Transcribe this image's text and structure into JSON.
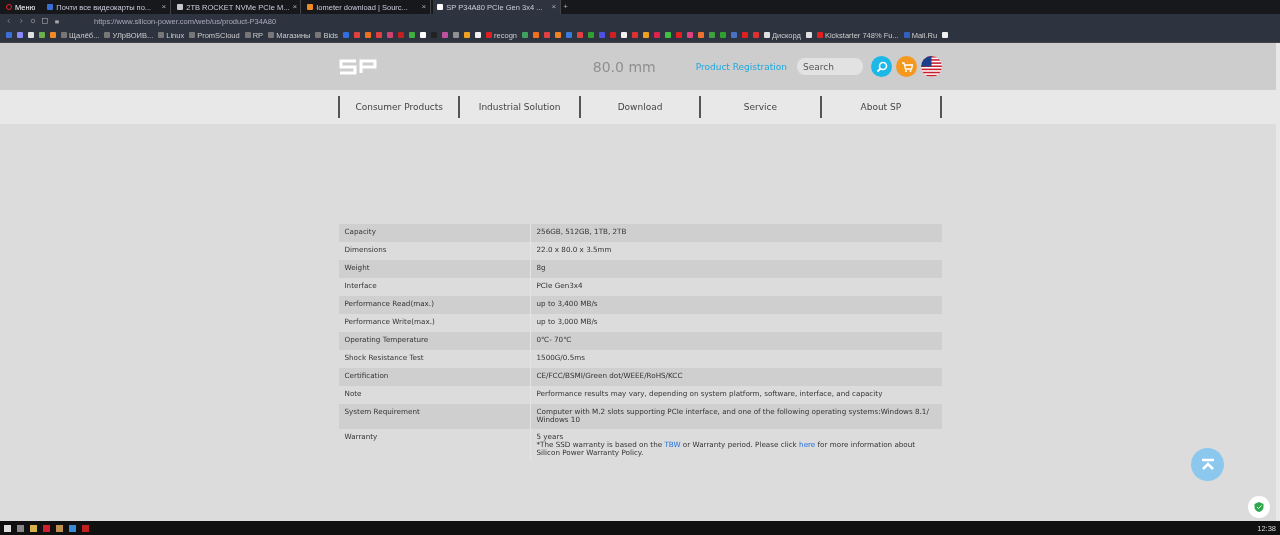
{
  "browser": {
    "menu_label": "Меню",
    "tabs": [
      {
        "title": "Почти все видеокарты по...",
        "selected": false,
        "color": "#3b6fd8",
        "close": "×"
      },
      {
        "title": "2TB ROCKET NVMe PCIe M...",
        "selected": false,
        "color": "#c8c8c8",
        "close": "×"
      },
      {
        "title": "Iometer download | Sourc...",
        "selected": false,
        "color": "#f08a24",
        "close": "×"
      },
      {
        "title": "SP P34A80 PCIe Gen 3x4 ...",
        "selected": true,
        "color": "#ffffff",
        "close": "×"
      }
    ],
    "new_tab": "+",
    "url": "https://www.silicon-power.com/web/us/product-P34A80",
    "bookmarks": [
      {
        "color": "#3b6fd8"
      },
      {
        "color": "#8a8aff"
      },
      {
        "color": "#e0e0e0"
      },
      {
        "color": "#6ab04c"
      },
      {
        "color": "#f08a24"
      },
      {
        "label": "Щалёб...",
        "color": "#777777"
      },
      {
        "label": "УЛрВОИВ...",
        "color": "#777777"
      },
      {
        "label": "Linux",
        "color": "#777777"
      },
      {
        "label": "PromSCloud",
        "color": "#777777"
      },
      {
        "label": "RP",
        "color": "#777777"
      },
      {
        "label": "Магазины",
        "color": "#777777"
      },
      {
        "label": "Bids",
        "color": "#777777"
      },
      {
        "color": "#2f6fe0"
      },
      {
        "color": "#e04040"
      },
      {
        "color": "#f07020"
      },
      {
        "color": "#e04040"
      },
      {
        "color": "#d04070"
      },
      {
        "color": "#c02020"
      },
      {
        "color": "#40b040"
      },
      {
        "color": "#ffffff"
      },
      {
        "color": "#222222"
      },
      {
        "color": "#c050a0"
      },
      {
        "color": "#909090"
      },
      {
        "color": "#f0a020"
      },
      {
        "color": "#f0f0f0"
      },
      {
        "label": "recogn",
        "color": "#e02020"
      },
      {
        "color": "#40a060"
      },
      {
        "color": "#f07020"
      },
      {
        "color": "#e04040"
      },
      {
        "color": "#f08020"
      },
      {
        "color": "#3a7ad8"
      },
      {
        "color": "#e04040"
      },
      {
        "color": "#30a030"
      },
      {
        "color": "#5050e0"
      },
      {
        "color": "#d02020"
      },
      {
        "color": "#f0f0f0"
      },
      {
        "color": "#e03030"
      },
      {
        "color": "#f0a020"
      },
      {
        "color": "#e02050"
      },
      {
        "color": "#40c040"
      },
      {
        "color": "#e02020"
      },
      {
        "color": "#e04080"
      },
      {
        "color": "#f07030"
      },
      {
        "color": "#40a040"
      },
      {
        "color": "#30a030"
      },
      {
        "color": "#4a70c0"
      },
      {
        "color": "#e02020"
      },
      {
        "color": "#e03030"
      },
      {
        "label": "Дискорд",
        "color": "#e0e0e0"
      },
      {
        "color": "#e0e0e0"
      },
      {
        "label": "Kickstarter 748% Fu...",
        "color": "#e02020"
      },
      {
        "label": "Mail.Ru",
        "color": "#3060c0"
      },
      {
        "color": "#f0f0f0"
      }
    ]
  },
  "header": {
    "caption": "80.0 mm",
    "registration_link": "Product Registration",
    "search": {
      "placeholder": "Search"
    }
  },
  "nav": [
    {
      "label": "Consumer Products"
    },
    {
      "label": "Industrial Solution"
    },
    {
      "label": "Download"
    },
    {
      "label": "Service"
    },
    {
      "label": "About SP"
    }
  ],
  "specs": [
    {
      "name": "Capacity",
      "value": [
        "256GB, 512GB, 1TB, 2TB"
      ]
    },
    {
      "name": "Dimensions",
      "value": [
        "22.0 x 80.0 x 3.5mm"
      ]
    },
    {
      "name": "Weight",
      "value": [
        "8g"
      ]
    },
    {
      "name": "Interface",
      "value": [
        "PCIe Gen3x4"
      ]
    },
    {
      "name": "Performance Read(max.)",
      "value": [
        "up to 3,400 MB/s"
      ]
    },
    {
      "name": "Performance Write(max.)",
      "value": [
        "up to 3,000 MB/s"
      ]
    },
    {
      "name": "Operating Temperature",
      "value": [
        "0℃- 70℃"
      ]
    },
    {
      "name": "Shock Resistance Test",
      "value": [
        "1500G/0.5ms"
      ]
    },
    {
      "name": "Certification",
      "value": [
        "CE/FCC/BSMI/Green dot/WEEE/RoHS/KCC"
      ]
    },
    {
      "name": "Note",
      "value": [
        "Performance results may vary, depending on system platform, software, interface, and capacity"
      ]
    },
    {
      "name": "System Requirement",
      "value": [
        "Computer with M.2 slots supporting PCIe interface, and one of the following operating systems:Windows 8.1/ Windows 10"
      ]
    },
    {
      "name": "Warranty",
      "value": [
        "5 years"
      ],
      "note": [
        {
          "kind": "text",
          "text": "*The SSD warranty is based on the "
        },
        {
          "kind": "link",
          "text": "TBW"
        },
        {
          "kind": "text",
          "text": " or Warranty period. Please click "
        },
        {
          "kind": "link",
          "text": "here"
        },
        {
          "kind": "text",
          "text": " for more information about Silicon Power Warranty Policy."
        }
      ]
    }
  ],
  "taskbar": {
    "clock": "12:38"
  }
}
